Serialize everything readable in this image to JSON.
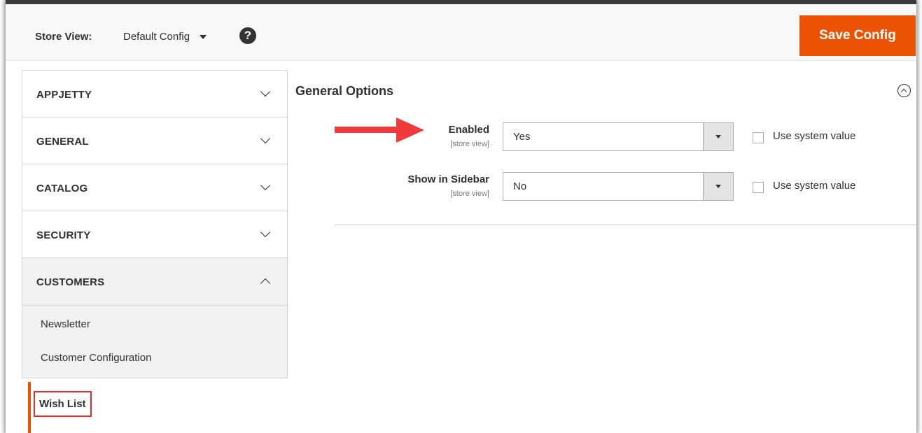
{
  "header": {
    "store_view_label": "Store View:",
    "store_view_value": "Default Config",
    "help_icon": "?",
    "save_label": "Save Config",
    "accent_color": "#eb5202"
  },
  "sidebar": {
    "items": [
      {
        "label": "APPJETTY",
        "icon": "chevron-down-icon"
      },
      {
        "label": "GENERAL",
        "icon": "chevron-down-icon"
      },
      {
        "label": "CATALOG",
        "icon": "chevron-down-icon"
      },
      {
        "label": "SECURITY",
        "icon": "chevron-down-icon"
      },
      {
        "label": "CUSTOMERS",
        "icon": "chevron-up-icon"
      }
    ],
    "sub_items": [
      {
        "label": "Newsletter"
      },
      {
        "label": "Customer Configuration"
      },
      {
        "label": "Wish List"
      }
    ]
  },
  "main": {
    "section_title": "General Options",
    "fields": [
      {
        "label": "Enabled",
        "scope": "[store view]",
        "value": "Yes",
        "use_system": "Use system value"
      },
      {
        "label": "Show in Sidebar",
        "scope": "[store view]",
        "value": "No",
        "use_system": "Use system value"
      }
    ]
  },
  "annotations": {
    "arrow_color": "#ef3b3b",
    "highlight_color": "#e02b27"
  }
}
